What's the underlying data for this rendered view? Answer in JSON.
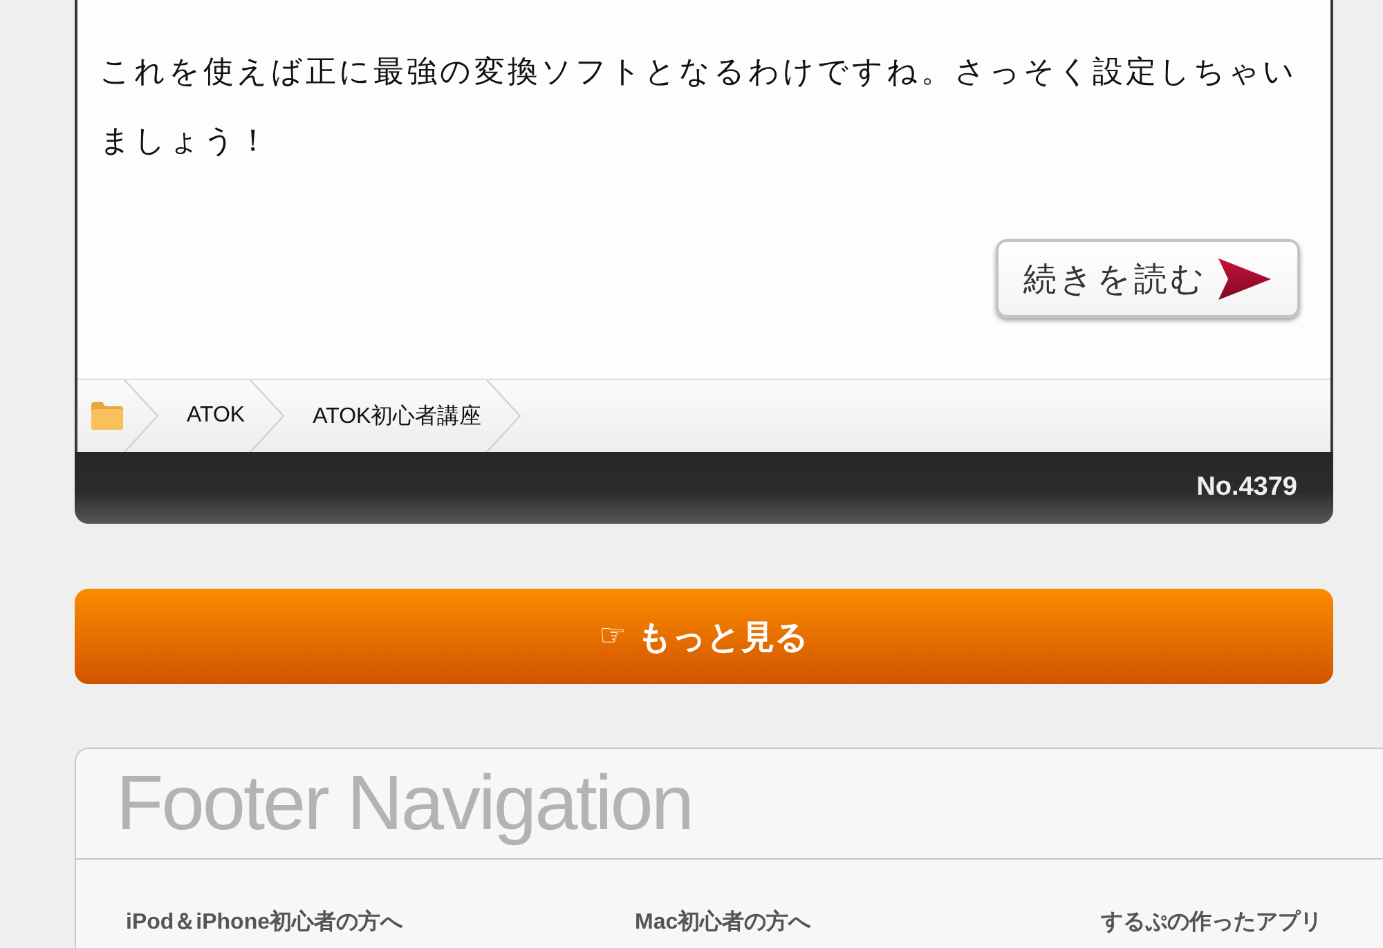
{
  "article": {
    "paragraph": "これを使えば正に最強の変換ソフトとなるわけですね。さっそく設定しちゃいましょう！",
    "read_more_button": {
      "label": "続きを読む"
    },
    "breadcrumbs": [
      {
        "label": "ATOK"
      },
      {
        "label": "ATOK初心者講座"
      }
    ],
    "entry_number": "No.4379"
  },
  "more_button": {
    "icon": "☞",
    "label": "もっと見る"
  },
  "footer_navigation": {
    "title": "Footer Navigation",
    "columns": [
      {
        "heading": "iPod＆iPhone初心者の方へ"
      },
      {
        "heading": "Mac初心者の方へ"
      },
      {
        "heading": "するぷの作ったアプリ"
      }
    ]
  }
}
